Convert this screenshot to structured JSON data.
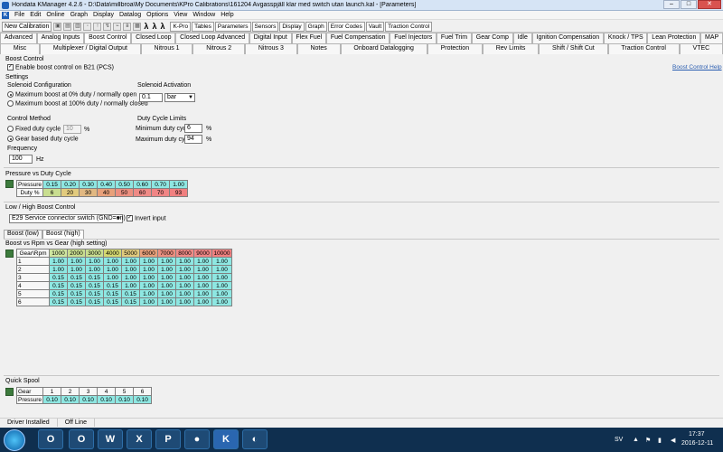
{
  "window": {
    "title": "Hondata KManager 4.2.6 - D:\\Data\\millbroa\\My Documents\\KPro Calibrations\\161204 Avgasspjäll klar med switch utan launch.kal - [Parameters]",
    "controls": [
      "–",
      "□",
      "✕"
    ]
  },
  "menu": [
    "File",
    "Edit",
    "Online",
    "Graph",
    "Display",
    "Datalog",
    "Options",
    "View",
    "Window",
    "Help"
  ],
  "toolbar": {
    "new_calibration": "New Calibration",
    "tabs": [
      "K-Pro",
      "Tables",
      "Parameters",
      "Sensors",
      "Display",
      "Graph",
      "Error Codes",
      "Vault",
      "Traction Control"
    ]
  },
  "tabs_row1": [
    "Advanced",
    "Analog Inputs",
    "Boost Control",
    "Closed Loop",
    "Closed Loop Advanced",
    "Digital Input",
    "Flex Fuel",
    "Fuel Compensation",
    "Fuel Injectors",
    "Fuel Trim",
    "Gear Comp",
    "Idle",
    "Ignition Compensation",
    "Knock / TPS",
    "Lean Protection",
    "MAP"
  ],
  "tabs_row2": [
    "Misc",
    "Multiplexer / Digital Output",
    "Nitrous 1",
    "Nitrous 2",
    "Nitrous 3",
    "Notes",
    "Onboard Datalogging",
    "Protection",
    "Rev Limits",
    "Shift / Shift Cut",
    "Traction Control",
    "VTEC"
  ],
  "active_tab_row1": 2,
  "boost": {
    "section_title": "Boost Control",
    "enable_label": "Enable boost control on B21 (PCS)",
    "help_link": "Boost Control Help",
    "settings_title": "Settings",
    "solenoid_config_title": "Solenoid Configuration",
    "opt_max_open": "Maximum boost at 0% duty / normally open",
    "opt_max_closed": "Maximum boost at 100% duty / normally closed",
    "solenoid_activation_title": "Solenoid Activation",
    "activation_value": "0.1",
    "activation_unit": "bar",
    "control_method_title": "Control Method",
    "fixed_duty_label": "Fixed duty cycle",
    "fixed_duty_value": "10",
    "fixed_duty_unit": "%",
    "gear_based_label": "Gear based duty cycle",
    "duty_limits_title": "Duty Cycle Limits",
    "min_duty_label": "Minimum duty cycle",
    "min_duty_value": "6",
    "max_duty_label": "Maximum duty cycle",
    "max_duty_value": "94",
    "pct": "%",
    "frequency_title": "Frequency",
    "frequency_value": "100",
    "frequency_unit": "Hz"
  },
  "pvd": {
    "title": "Pressure vs Duty Cycle",
    "pressure_label": "Pressure",
    "duty_label": "Duty %",
    "pressure": [
      "0.15",
      "0.20",
      "0.30",
      "0.40",
      "0.50",
      "0.60",
      "0.70",
      "1.00"
    ],
    "duty": [
      "6",
      "20",
      "30",
      "40",
      "50",
      "60",
      "70",
      "93"
    ]
  },
  "lowhigh": {
    "title": "Low / High Boost Control",
    "select_value": "E29 Service connector switch (GND=on)",
    "invert_label": "Invert input"
  },
  "subtabs": [
    "Boost (low)",
    "Boost (high)"
  ],
  "active_subtab": 1,
  "rpm_table": {
    "title": "Boost vs Rpm vs Gear (high setting)",
    "corner": "Gear\\Rpm",
    "rpm": [
      "1000",
      "2000",
      "3000",
      "4000",
      "5000",
      "6000",
      "7000",
      "8000",
      "9000",
      "10000"
    ],
    "rows": [
      {
        "gear": "1",
        "values": [
          "1.00",
          "1.00",
          "1.00",
          "1.00",
          "1.00",
          "1.00",
          "1.00",
          "1.00",
          "1.00",
          "1.00"
        ]
      },
      {
        "gear": "2",
        "values": [
          "1.00",
          "1.00",
          "1.00",
          "1.00",
          "1.00",
          "1.00",
          "1.00",
          "1.00",
          "1.00",
          "1.00"
        ]
      },
      {
        "gear": "3",
        "values": [
          "0.15",
          "0.15",
          "0.15",
          "1.00",
          "1.00",
          "1.00",
          "1.00",
          "1.00",
          "1.00",
          "1.00"
        ]
      },
      {
        "gear": "4",
        "values": [
          "0.15",
          "0.15",
          "0.15",
          "0.15",
          "1.00",
          "1.00",
          "1.00",
          "1.00",
          "1.00",
          "1.00"
        ]
      },
      {
        "gear": "5",
        "values": [
          "0.15",
          "0.15",
          "0.15",
          "0.15",
          "0.15",
          "1.00",
          "1.00",
          "1.00",
          "1.00",
          "1.00"
        ]
      },
      {
        "gear": "6",
        "values": [
          "0.15",
          "0.15",
          "0.15",
          "0.15",
          "0.15",
          "1.00",
          "1.00",
          "1.00",
          "1.00",
          "1.00"
        ]
      }
    ]
  },
  "quickspool": {
    "title": "Quick Spool",
    "gear_label": "Gear",
    "pressure_label": "Pressure",
    "gears": [
      "1",
      "2",
      "3",
      "4",
      "5",
      "6"
    ],
    "pressure": [
      "0.10",
      "0.10",
      "0.10",
      "0.10",
      "0.10",
      "0.10"
    ]
  },
  "status": [
    "Driver Installed",
    "Off Line"
  ],
  "taskbar": {
    "lang": "SV",
    "time": "17:37",
    "date": "2016-12-11",
    "apps": [
      "O",
      "W",
      "X",
      "P",
      "●",
      "K",
      "◐"
    ]
  }
}
